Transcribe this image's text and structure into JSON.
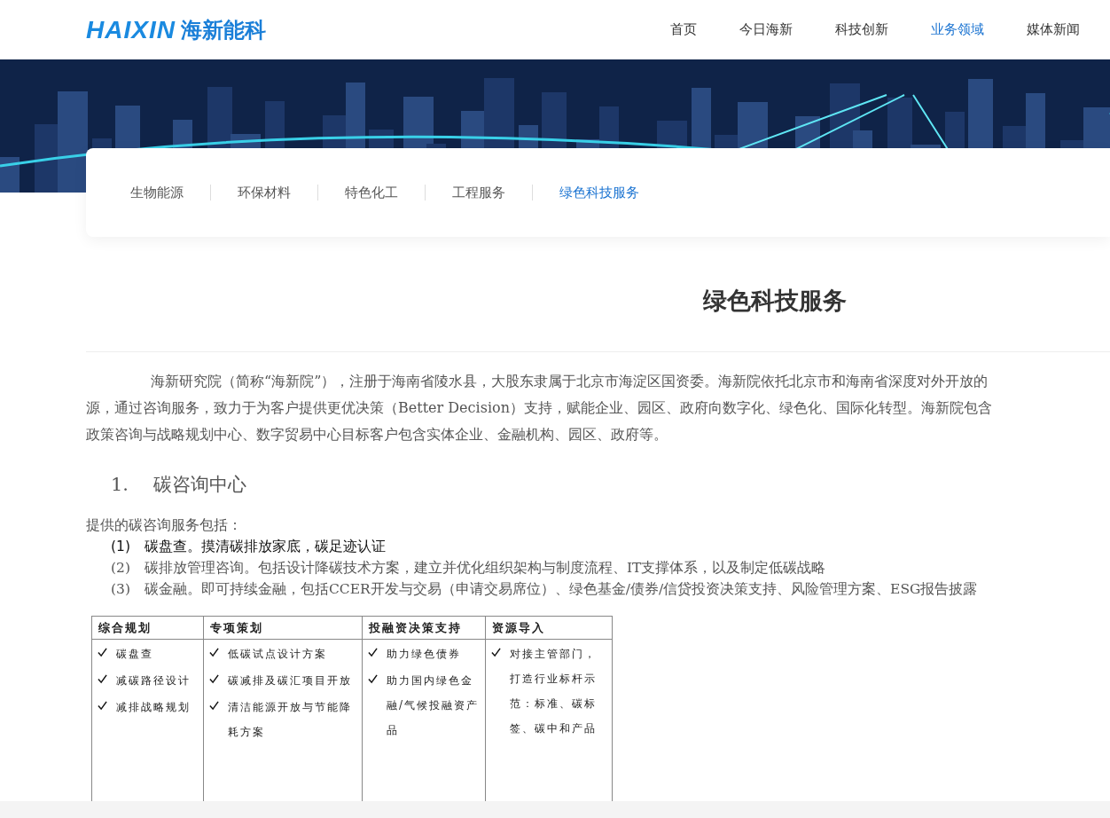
{
  "header": {
    "logo": {
      "mark": "HAIXIN",
      "name": "海新能科"
    },
    "nav": [
      {
        "label": "首页",
        "selected": false
      },
      {
        "label": "今日海新",
        "selected": false
      },
      {
        "label": "科技创新",
        "selected": false
      },
      {
        "label": "业务领域",
        "selected": true
      },
      {
        "label": "媒体新闻",
        "selected": false
      }
    ]
  },
  "banner": {
    "kind": "picture"
  },
  "subnav": [
    {
      "label": "生物能源",
      "selected": false
    },
    {
      "label": "环保材料",
      "selected": false
    },
    {
      "label": "特色化工",
      "selected": false
    },
    {
      "label": "工程服务",
      "selected": false
    },
    {
      "label": "绿色科技服务",
      "selected": true
    }
  ],
  "title": "绿色科技服务",
  "intro_lines": [
    "海新研究院（简称“海新院”），注册于海南省陵水县，大股东隶属于北京市海淀区国资委。海新院依托北京市和海南省深度对外开放的",
    "源，通过咨询服务，致力于为客户提供更优决策（Better Decision）支持，赋能企业、园区、政府向数字化、绿色化、国际化转型。海新院包含",
    "政策咨询与战略规划中心、数字贸易中心目标客户包含实体企业、金融机构、园区、政府等。"
  ],
  "section": {
    "number": "1.",
    "title": "碳咨询中心"
  },
  "services_intro": "提供的碳咨询服务包括：",
  "services": [
    {
      "number": "(1)",
      "text": "碳盘查。摸清碳排放家底，碳足迹认证",
      "kind": "dark"
    },
    {
      "number": "(2)",
      "text": "碳排放管理咨询。包括设计降碳技术方案，建立并优化组织架构与制度流程、IT支撑体系，以及制定低碳战略",
      "kind": "plain"
    },
    {
      "number": "(3)",
      "text": "碳金融。即可持续金融，包括CCER开发与交易（申请交易席位）、绿色基金/债券/信贷投资决策支持、风险管理方案、ESG报告披露",
      "kind": "plain"
    }
  ],
  "table": {
    "columns": [
      {
        "heading": "综合规划",
        "items": [
          "碳盘查",
          "减碳路径设计",
          "减排战略规划"
        ]
      },
      {
        "heading": "专项策划",
        "items": [
          "低碳试点设计方案",
          "碳减排及碳汇项目开放",
          "清洁能源开放与节能降耗方案"
        ]
      },
      {
        "heading": "投融资决策支持",
        "items": [
          "助力绿色债券",
          "助力国内绿色金融/气候投融资产品"
        ]
      },
      {
        "heading": "资源导入",
        "items": [
          "对接主管部门，打造行业标杆示范：标准、碳标签、碳中和产品"
        ]
      }
    ]
  }
}
